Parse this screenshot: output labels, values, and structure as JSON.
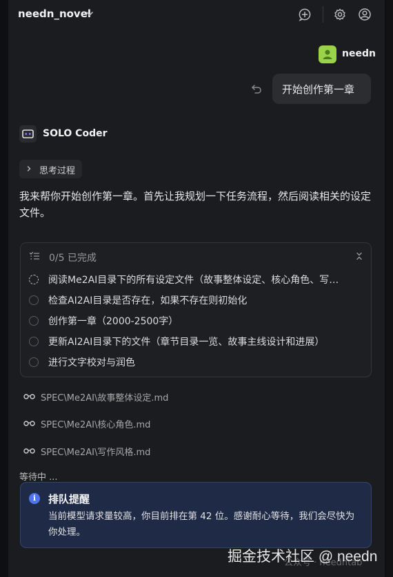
{
  "header": {
    "project": "needn_novel"
  },
  "user": {
    "name": "needn",
    "message": "开始创作第一章"
  },
  "agent": {
    "name": "SOLO Coder",
    "thinking_label": "思考过程",
    "reply": "我来帮你开始创作第一章。首先让我规划一下任务流程，然后阅读相关的设定文件。"
  },
  "todo": {
    "progress": "0/5 已完成",
    "items": [
      {
        "text": "阅读Me2AI目录下的所有设定文件（故事整体设定、核心角色、写…",
        "status": "in_progress"
      },
      {
        "text": "检查AI2AI目录是否存在，如果不存在则初始化",
        "status": "pending"
      },
      {
        "text": "创作第一章（2000-2500字）",
        "status": "pending"
      },
      {
        "text": "更新AI2AI目录下的文件（章节目录一览、故事主线设计和进展）",
        "status": "pending"
      },
      {
        "text": "进行文字校对与润色",
        "status": "pending"
      }
    ]
  },
  "files": [
    "SPEC\\Me2AI\\故事整体设定.md",
    "SPEC\\Me2AI\\核心角色.md",
    "SPEC\\Me2AI\\写作风格.md"
  ],
  "status_text": "等待中 ...",
  "notice": {
    "title": "排队提醒",
    "body": "当前模型请求量较高，你目前排在第 42 位。感谢耐心等待，我们会尽快为你处理。"
  },
  "watermark": {
    "main": "掘金技术社区 @ needn",
    "sub": "公众号 · needntab"
  },
  "icons": {
    "header": [
      "chevron-down-icon",
      "new-chat-icon",
      "settings-icon",
      "account-icon"
    ],
    "undo": "undo-icon",
    "agent": "solo-logo-icon",
    "todo": "checklist-icon",
    "file": "glasses-icon",
    "notice": "info-icon"
  },
  "colors": {
    "background": "#1b1c1f",
    "avatar": "#9ad34a",
    "notice_bg": "#1f2a47",
    "info_accent": "#4f74ee",
    "agent_logo_accent": "#8b6cf0"
  }
}
